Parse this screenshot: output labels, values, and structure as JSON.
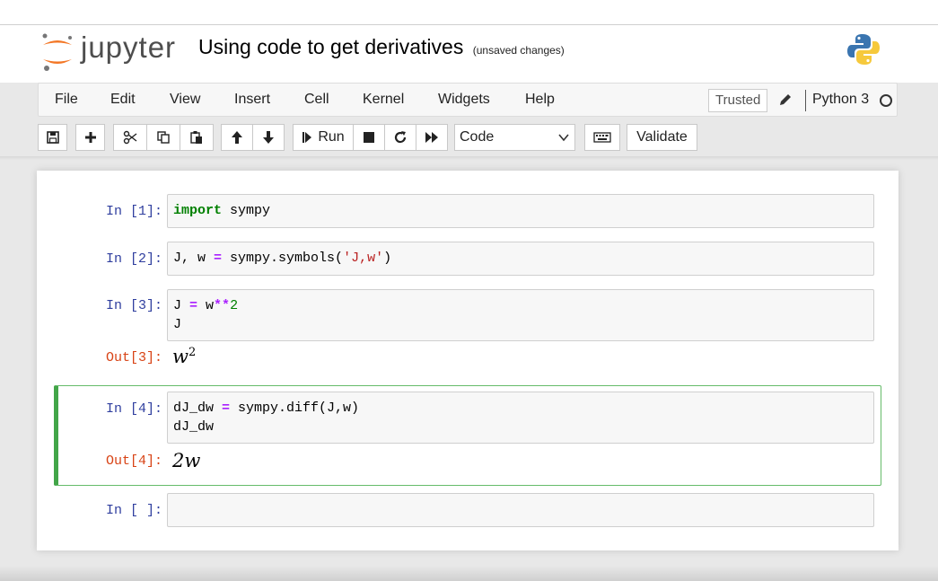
{
  "app": {
    "logo_text": "jupyter",
    "notebook_title": "Using code to get derivatives",
    "save_status": "(unsaved changes)"
  },
  "menu": {
    "items": [
      "File",
      "Edit",
      "View",
      "Insert",
      "Cell",
      "Kernel",
      "Widgets",
      "Help"
    ],
    "trusted_label": "Trusted",
    "kernel_name": "Python 3"
  },
  "toolbar": {
    "run_label": "Run",
    "cell_type": "Code",
    "validate_label": "Validate",
    "icons": [
      "save-icon",
      "plus-icon",
      "scissors-icon",
      "copy-icon",
      "paste-icon",
      "arrow-up-icon",
      "arrow-down-icon",
      "step-forward-icon",
      "stop-icon",
      "restart-icon",
      "fast-forward-icon",
      "keyboard-icon"
    ]
  },
  "cells": [
    {
      "in_prompt": "In [1]:",
      "code": [
        "import sympy"
      ]
    },
    {
      "in_prompt": "In [2]:",
      "code": [
        "J, w = sympy.symbols('J,w')"
      ]
    },
    {
      "in_prompt": "In [3]:",
      "code": [
        "J = w**2",
        "J"
      ],
      "out_prompt": "Out[3]:",
      "output_base": "w",
      "output_exp": "2"
    },
    {
      "in_prompt": "In [4]:",
      "code": [
        "dJ_dw = sympy.diff(J,w)",
        "dJ_dw"
      ],
      "out_prompt": "Out[4]:",
      "output": "2w",
      "selected": true
    },
    {
      "in_prompt": "In [ ]:",
      "code": [
        ""
      ]
    }
  ],
  "colors": {
    "in_prompt": "#303f9f",
    "out_prompt": "#d84315",
    "keyword": "#008000",
    "operator": "#aa22ff",
    "string": "#ba2121",
    "selected_border": "#42a548",
    "jupyter_orange": "#f37726"
  }
}
